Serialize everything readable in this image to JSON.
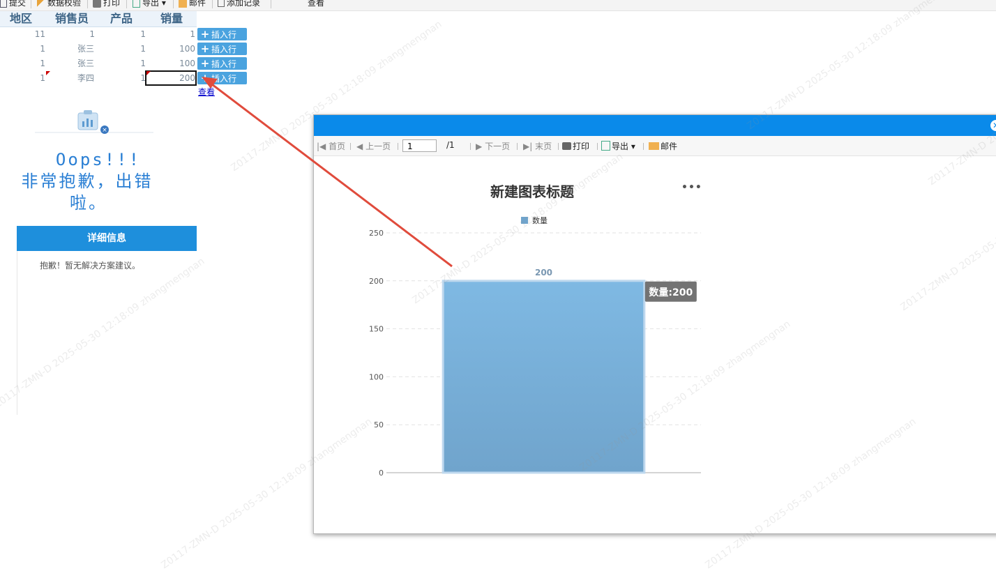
{
  "toolbar": {
    "submit": "提交",
    "validate": "数据校验",
    "print": "打印",
    "export": "导出",
    "email": "邮件",
    "add_record": "添加记录",
    "view": "查看"
  },
  "table": {
    "headers": [
      "地区",
      "销售员",
      "产品",
      "销量"
    ],
    "rows": [
      {
        "region": "11",
        "salesperson": "1",
        "product": "1",
        "sales": "1"
      },
      {
        "region": "1",
        "salesperson": "张三",
        "product": "1",
        "sales": "100"
      },
      {
        "region": "1",
        "salesperson": "张三",
        "product": "1",
        "sales": "100"
      },
      {
        "region": "1",
        "salesperson": "李四",
        "product": "1",
        "sales": "200"
      }
    ],
    "insert_label": "插入行",
    "view_link": "查看"
  },
  "error": {
    "line1": "Oops!!!",
    "line2": "非常抱歉，出错",
    "line3": "啦。",
    "detail_header": "详细信息",
    "detail_text": "抱歉！暂无解决方案建议。"
  },
  "dialog": {
    "toolbar": {
      "first": "首页",
      "prev": "上一页",
      "page_value": "1",
      "total": "/1",
      "next": "下一页",
      "last": "末页",
      "print": "打印",
      "export": "导出",
      "email": "邮件"
    },
    "chart_title": "新建图表标题"
  },
  "chart_data": {
    "type": "bar",
    "title": "新建图表标题",
    "categories": [
      ""
    ],
    "series": [
      {
        "name": "数量",
        "values": [
          200
        ]
      }
    ],
    "ylim": [
      0,
      250
    ],
    "yticks": [
      0,
      50,
      100,
      150,
      200,
      250
    ],
    "data_labels": [
      "200"
    ],
    "tooltip": "数量:200",
    "grid": true,
    "legend": "top-center",
    "colors": {
      "bar_top": "#7fb9e3",
      "bar_bottom": "#70a4cc",
      "accent": "#0a8aea"
    }
  },
  "watermark": "Z0117-ZMN-D 2025-05-30 12:18:09 zhangmengnan"
}
